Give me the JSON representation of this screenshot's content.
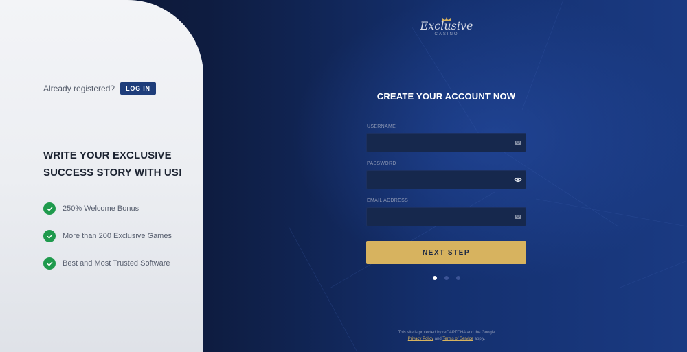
{
  "brand": {
    "logo_main": "Exclusive",
    "logo_sub": "CASINO",
    "gold": "#d7b35f",
    "navy": "#1e3d7a"
  },
  "left": {
    "already_registered": "Already registered?",
    "login_label": "LOG IN",
    "headline": "WRITE YOUR EXCLUSIVE SUCCESS STORY WITH US!",
    "features": [
      "250% Welcome Bonus",
      "More than 200 Exclusive Games",
      "Best and Most Trusted Software"
    ]
  },
  "form": {
    "title": "CREATE YOUR ACCOUNT NOW",
    "username_label": "USERNAME",
    "username_value": "",
    "password_label": "PASSWORD",
    "password_value": "",
    "email_label": "EMAIL ADDRESS",
    "email_value": "",
    "next_label": "NEXT STEP",
    "step_current": 1,
    "step_total": 3
  },
  "footer": {
    "line1": "This site is protected by reCAPTCHA and the Google",
    "privacy": "Privacy Policy",
    "and": "and",
    "terms": "Terms of Service",
    "apply": "apply."
  }
}
